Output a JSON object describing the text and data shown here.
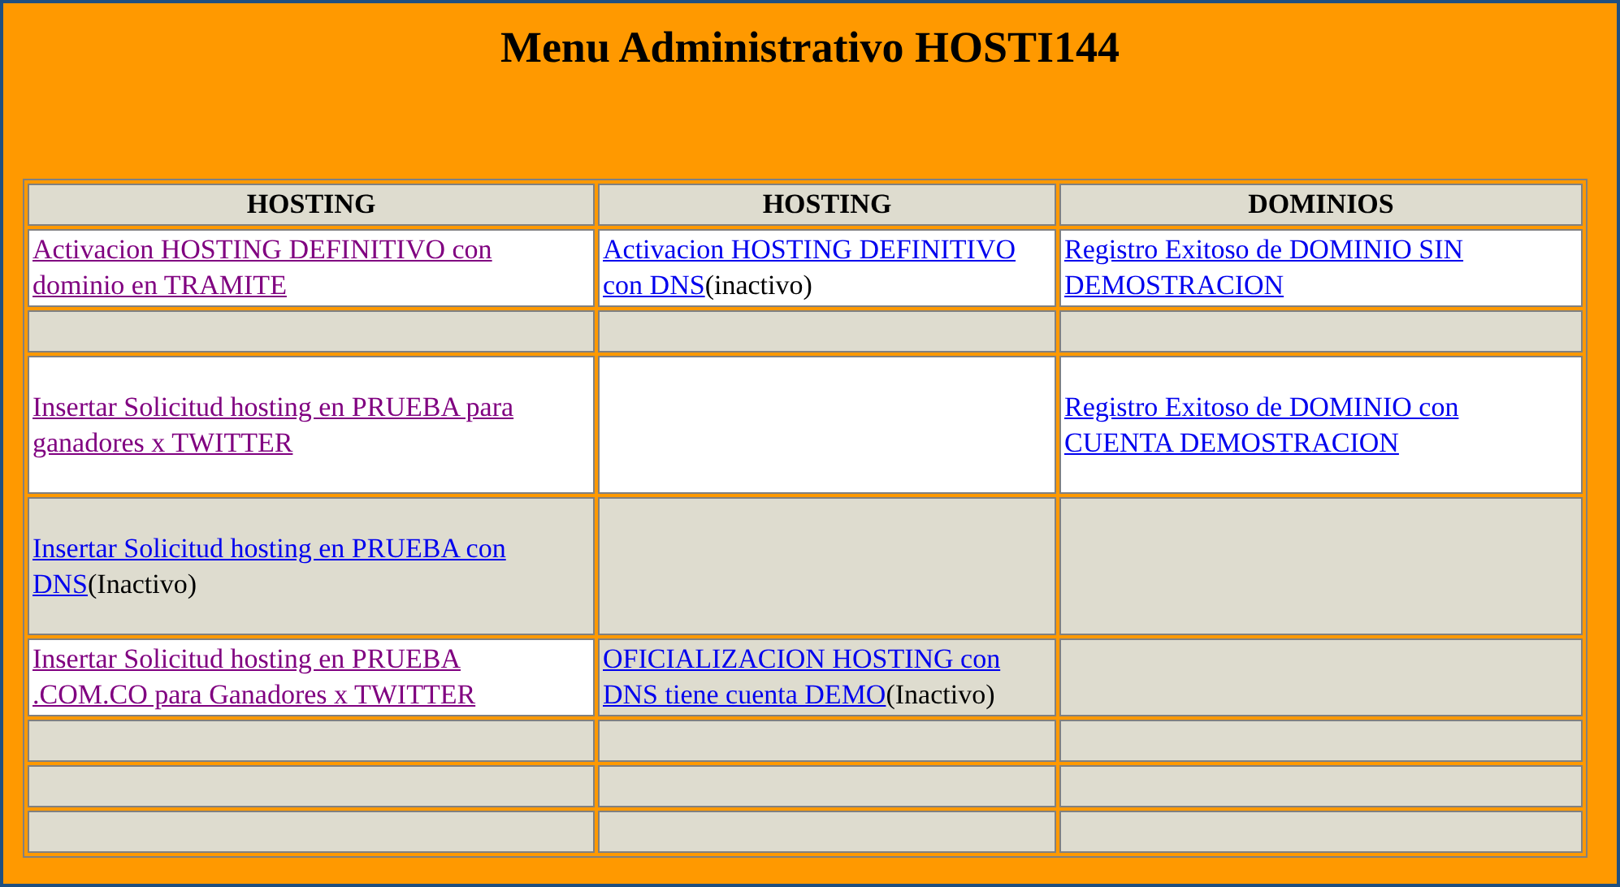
{
  "title": "Menu Administrativo HOSTI144",
  "table": {
    "columns": [
      "HOSTING",
      "HOSTING",
      "DOMINIOS"
    ],
    "rows": [
      [
        {
          "shaded": false,
          "link": [
            "Activacion HOSTING DEFINITIVO con",
            "dominio en TRAMITE"
          ],
          "visited": true
        },
        {
          "shaded": false,
          "link": [
            "Activacion HOSTING DEFINITIVO",
            "con DNS"
          ],
          "visited": false,
          "note": "(inactivo)"
        },
        {
          "shaded": false,
          "link": [
            "Registro Exitoso de DOMINIO SIN",
            "DEMOSTRACION"
          ],
          "visited": false
        }
      ],
      [
        {
          "shaded": true
        },
        {
          "shaded": true
        },
        {
          "shaded": true
        }
      ],
      [
        {
          "shaded": false,
          "link": [
            "Insertar Solicitud hosting en PRUEBA para",
            "ganadores x TWITTER"
          ],
          "visited": true
        },
        {
          "shaded": false
        },
        {
          "shaded": false,
          "link": [
            "Registro Exitoso de DOMINIO con",
            "CUENTA DEMOSTRACION"
          ],
          "visited": false
        }
      ],
      [
        {
          "shaded": true,
          "link": [
            "Insertar Solicitud hosting en PRUEBA con",
            "DNS"
          ],
          "visited": false,
          "note": "(Inactivo)"
        },
        {
          "shaded": true
        },
        {
          "shaded": true
        }
      ],
      [
        {
          "shaded": false,
          "link": [
            "Insertar Solicitud hosting en PRUEBA",
            ".COM.CO para Ganadores x TWITTER"
          ],
          "visited": true
        },
        {
          "shaded": true,
          "link": [
            "OFICIALIZACION HOSTING con",
            "DNS tiene cuenta DEMO"
          ],
          "visited": false,
          "note": "(Inactivo)"
        },
        {
          "shaded": true
        }
      ],
      [
        {
          "shaded": true
        },
        {
          "shaded": true
        },
        {
          "shaded": true
        }
      ],
      [
        {
          "shaded": true
        },
        {
          "shaded": true
        },
        {
          "shaded": true
        }
      ],
      [
        {
          "shaded": true
        },
        {
          "shaded": true
        },
        {
          "shaded": true
        }
      ]
    ]
  }
}
